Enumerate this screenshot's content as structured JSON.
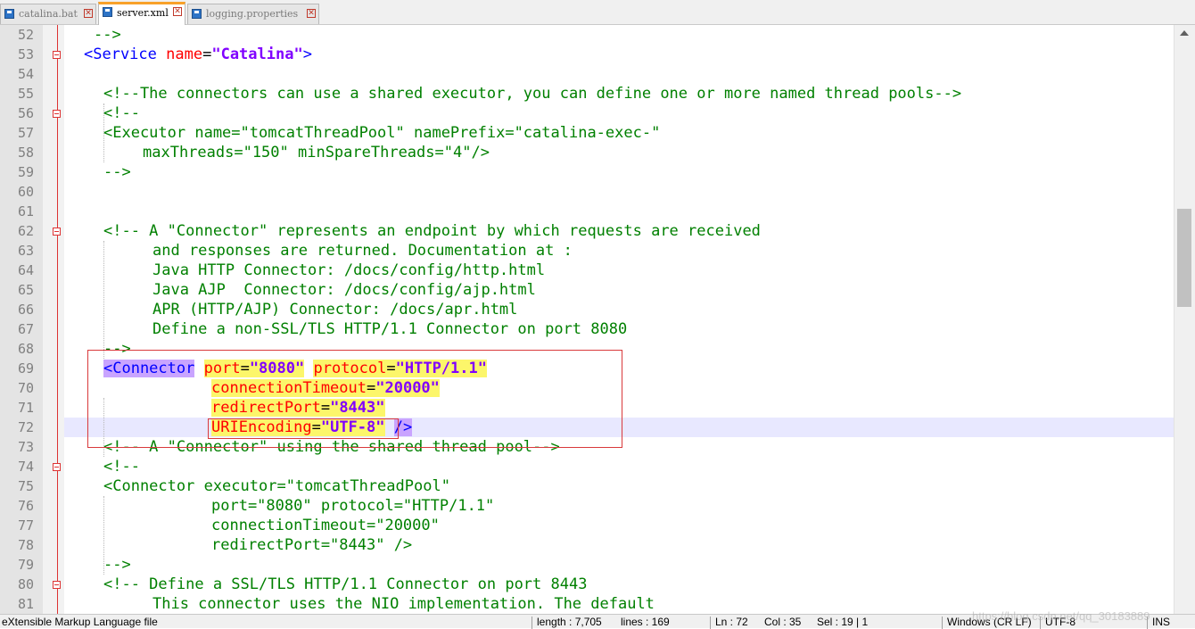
{
  "tabs": [
    {
      "label": "catalina.bat",
      "active": false,
      "icon": "file-save-icon"
    },
    {
      "label": "server.xml",
      "active": true,
      "icon": "file-save-icon"
    },
    {
      "label": "logging.properties",
      "active": false,
      "icon": "file-save-icon"
    }
  ],
  "line_numbers": [
    "52",
    "53",
    "54",
    "55",
    "56",
    "57",
    "58",
    "59",
    "60",
    "61",
    "62",
    "63",
    "64",
    "65",
    "66",
    "67",
    "68",
    "69",
    "70",
    "71",
    "72",
    "73",
    "74",
    "75",
    "76",
    "77",
    "78",
    "79",
    "80",
    "81"
  ],
  "code": {
    "l52": "-->",
    "l53_open": "<Service",
    "l53_attr": "name",
    "l53_eq": "=",
    "l53_val": "\"Catalina\"",
    "l53_close": ">",
    "l55": "<!--The connectors can use a shared executor, you can define one or more named thread pools-->",
    "l56": "<!--",
    "l57": "<Executor name=\"tomcatThreadPool\" namePrefix=\"catalina-exec-\"",
    "l58": "maxThreads=\"150\" minSpareThreads=\"4\"/>",
    "l59": "-->",
    "l62": "<!-- A \"Connector\" represents an endpoint by which requests are received",
    "l63": "and responses are returned. Documentation at :",
    "l64": "Java HTTP Connector: /docs/config/http.html",
    "l65": "Java AJP  Connector: /docs/config/ajp.html",
    "l66": "APR (HTTP/AJP) Connector: /docs/apr.html",
    "l67": "Define a non-SSL/TLS HTTP/1.1 Connector on port 8080",
    "l68": "-->",
    "l69_tag": "<Connector",
    "l69_attr1": "port",
    "l69_val1": "\"8080\"",
    "l69_attr2": "protocol",
    "l69_val2": "\"HTTP/1.1\"",
    "l70_attr": "connectionTimeout",
    "l70_val": "\"20000\"",
    "l71_attr": "redirectPort",
    "l71_val": "\"8443\"",
    "l72_attr": "URIEncoding",
    "l72_val": "\"UTF-8\"",
    "l72_close": "/>",
    "l73": "<!-- A \"Connector\" using the shared thread pool-->",
    "l74": "<!--",
    "l75": "<Connector executor=\"tomcatThreadPool\"",
    "l76": "port=\"8080\" protocol=\"HTTP/1.1\"",
    "l77": "connectionTimeout=\"20000\"",
    "l78": "redirectPort=\"8443\" />",
    "l79": "-->",
    "l80": "<!-- Define a SSL/TLS HTTP/1.1 Connector on port 8443",
    "l81": "This connector uses the NIO implementation. The default",
    "eq": "="
  },
  "status": {
    "filetype": "eXtensible Markup Language file",
    "length": "length : 7,705",
    "lines": "lines : 169",
    "ln": "Ln : 72",
    "col": "Col : 35",
    "sel": "Sel : 19 | 1",
    "eol": "Windows (CR LF)",
    "encoding": "UTF-8",
    "mode": "INS"
  },
  "watermark": "https://blog.csdn.net/qq_30183889",
  "colors": {
    "comment": "#008000",
    "tag": "#0000ff",
    "attribute": "#ff0000",
    "value": "#8000ff",
    "highlight": "#fcf66a",
    "current_line": "#e8e8ff",
    "annotation_box": "#d9393b",
    "active_tab_accent": "#f8a12a"
  }
}
